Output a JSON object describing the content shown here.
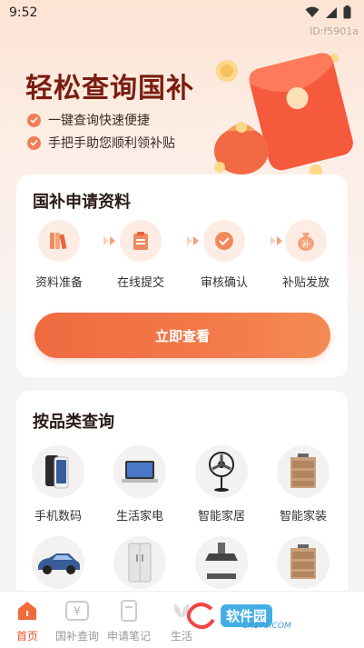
{
  "status_bar": {
    "time": "9:52",
    "app_id": "ID:f5901a"
  },
  "hero": {
    "title": "轻松查询国补",
    "bullets": [
      "一键查询快速便捷",
      "手把手助您顺利领补贴"
    ],
    "bag_char": "补"
  },
  "apply_card": {
    "title": "国补申请资料",
    "steps": [
      {
        "label": "资料准备",
        "icon": "books-icon"
      },
      {
        "label": "在线提交",
        "icon": "clipboard-icon"
      },
      {
        "label": "审核确认",
        "icon": "check-badge-icon"
      },
      {
        "label": "补贴发放",
        "icon": "money-bag-icon",
        "glyph": "补"
      }
    ],
    "cta_label": "立即查看"
  },
  "category_card": {
    "title": "按品类查询",
    "items": [
      {
        "label": "手机数码",
        "icon": "phone-icon"
      },
      {
        "label": "生活家电",
        "icon": "laptop-icon"
      },
      {
        "label": "智能家居",
        "icon": "fan-icon"
      },
      {
        "label": "智能家装",
        "icon": "cabinet-icon"
      },
      {
        "label": "",
        "icon": "car-icon"
      },
      {
        "label": "",
        "icon": "fridge-icon"
      },
      {
        "label": "",
        "icon": "range-hood-icon"
      },
      {
        "label": "",
        "icon": "cabinet-icon"
      }
    ]
  },
  "tabbar": {
    "tabs": [
      {
        "label": "首页",
        "active": true
      },
      {
        "label": "国补查询",
        "active": false
      },
      {
        "label": "申请笔记",
        "active": false
      },
      {
        "label": "生活",
        "active": false
      }
    ]
  },
  "watermark": {
    "text": "软件园",
    "url": "CR173.COM"
  },
  "colors": {
    "accent": "#f06a40",
    "title": "#7a1d10"
  }
}
